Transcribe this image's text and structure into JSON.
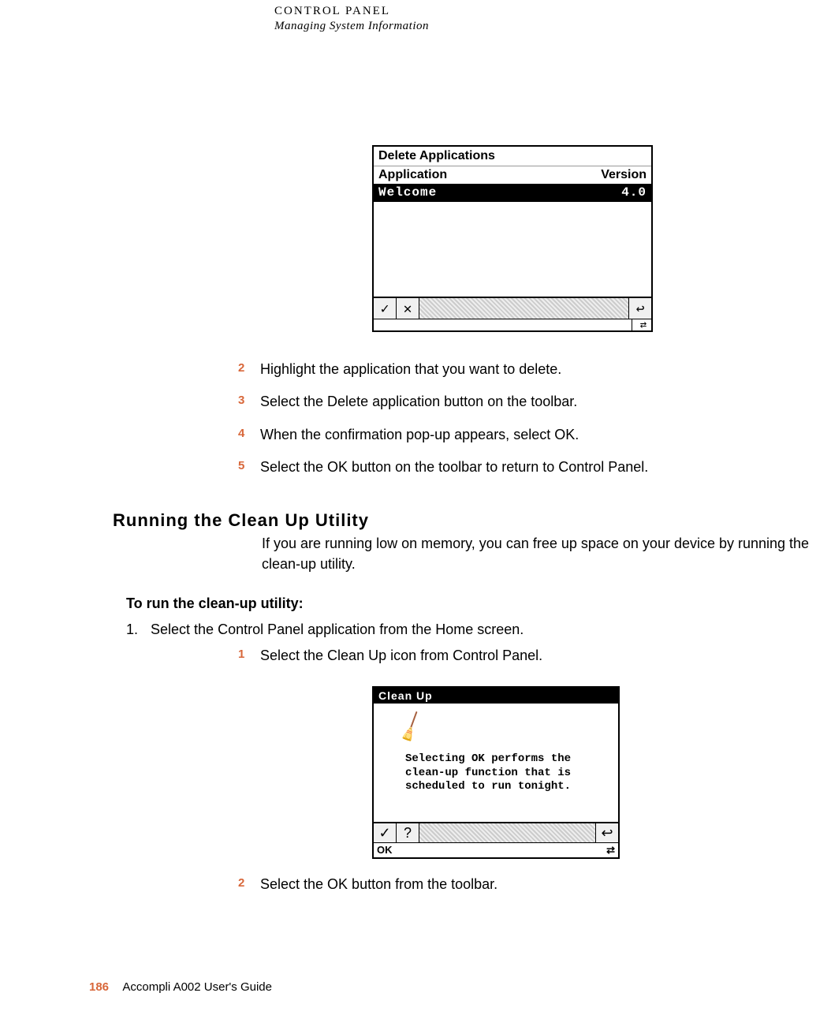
{
  "header": {
    "chapter": "CONTROL PANEL",
    "section": "Managing System Information"
  },
  "device1": {
    "title": "Delete Applications",
    "col_app": "Application",
    "col_ver": "Version",
    "row": {
      "name": "Welcome",
      "version": "4.0"
    }
  },
  "steps_a": [
    {
      "num": "2",
      "text": "Highlight the application that you want to delete."
    },
    {
      "num": "3",
      "text": "Select the Delete application button on the toolbar."
    },
    {
      "num": "4",
      "text": "When the confirmation pop-up appears, select OK."
    },
    {
      "num": "5",
      "text": "Select the OK button on the toolbar to return to Control Panel."
    }
  ],
  "section2": {
    "heading": "Running the Clean Up Utility",
    "intro": "If you are running low on memory, you can free up space on your device by running the clean-up utility.",
    "sub": "To run the clean-up utility:",
    "step1": {
      "num": "1.",
      "text": "Select the Control Panel application from the Home screen."
    }
  },
  "steps_b": [
    {
      "num": "1",
      "text": "Select the Clean Up icon from Control Panel."
    }
  ],
  "device2": {
    "title": "Clean Up",
    "message": "Selecting OK performs the clean-up function that is scheduled to run tonight.",
    "ok_label": "OK"
  },
  "steps_c": [
    {
      "num": "2",
      "text": "Select the OK button from the toolbar."
    }
  ],
  "footer": {
    "page": "186",
    "guide": "Accompli A002 User's Guide"
  }
}
